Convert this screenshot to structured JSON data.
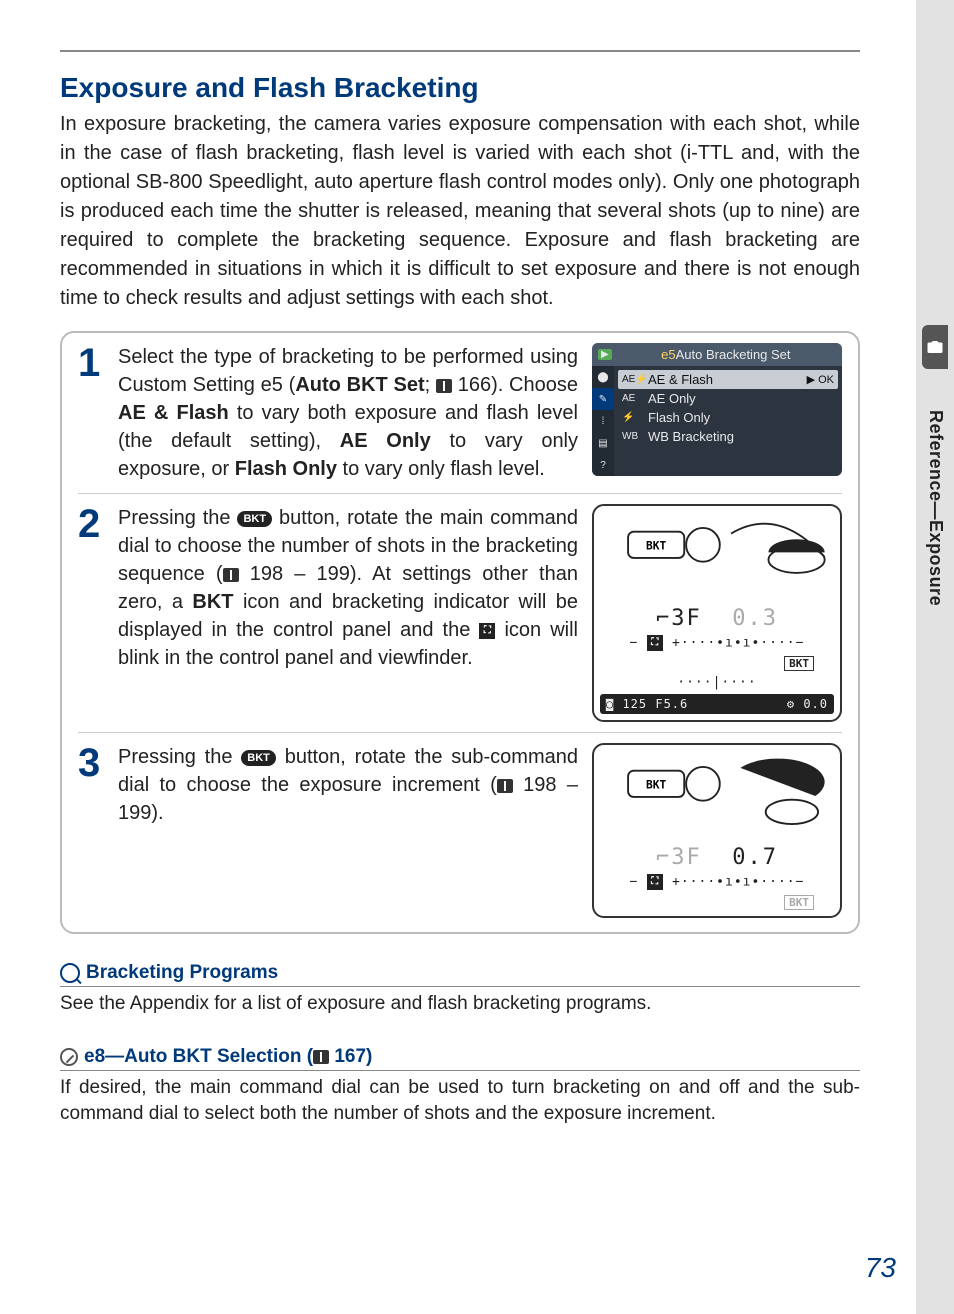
{
  "sidebar": {
    "label": "Reference—Exposure"
  },
  "title": "Exposure and Flash Bracketing",
  "intro": "In exposure bracketing, the camera varies exposure compensation with each shot, while in the case of flash bracketing, flash level is varied with each shot (i-TTL and, with the optional SB-800 Speedlight, auto aperture flash control modes only). Only one photograph is produced each time the shutter is released, meaning that several shots (up to nine) are required to complete the bracketing sequence. Exposure and flash bracketing are recommended in situations in which it is difficult to set exposure and there is not enough time to check results and adjust settings with each shot.",
  "steps": {
    "s1": {
      "num": "1",
      "t1": "Select the type of bracketing to be performed using Custom Setting e5 (",
      "bold1": "Auto BKT Set",
      "t2": "; ",
      "page_ref": " 166). Choose ",
      "bold2": "AE & Flash",
      "t3": " to vary both exposure and flash level (the default setting), ",
      "bold3": "AE Only",
      "t4": " to vary only exposure, or ",
      "bold4": "Flash Only",
      "t5": " to vary only flash level."
    },
    "s2": {
      "num": "2",
      "t1": "Pressing the ",
      "btn": "BKT",
      "t2": " button, rotate the main command dial to choose the number of shots in the bracketing sequence (",
      "page_ref": " 198 – 199). At settings other than zero, a ",
      "bold1": "BKT",
      "t3": " icon and bracketing indicator will be displayed in the control panel and the ",
      "t4": " icon will blink in the control panel and viewfinder."
    },
    "s3": {
      "num": "3",
      "t1": "Pressing the ",
      "btn": "BKT",
      "t2": " button, rotate the sub-command dial to choose the exposure increment (",
      "page_ref": " 198 – 199)."
    }
  },
  "menu": {
    "header_prefix": "e5",
    "header": "Auto Bracketing Set",
    "items": [
      {
        "code": "AE⚡",
        "label": "AE & Flash",
        "ok": "▶ OK"
      },
      {
        "code": "AE",
        "label": "AE Only"
      },
      {
        "code": "⚡",
        "label": "Flash Only"
      },
      {
        "code": "WB",
        "label": "WB Bracketing"
      }
    ]
  },
  "fig2": {
    "lcd_main_left": "⌐3F",
    "lcd_main_right": "0.3",
    "bkt_label": "BKT",
    "vf_left": "125  F5.6",
    "vf_right": "0.0"
  },
  "fig3": {
    "lcd_main_left": "⌐3F",
    "lcd_main_right": "0.7",
    "bkt_label": "BKT"
  },
  "notes": {
    "n1": {
      "title": "Bracketing Programs",
      "body": "See the Appendix for a list of exposure and flash bracketing programs."
    },
    "n2": {
      "title_a": "e8—Auto BKT Selection (",
      "title_pg": " 167)",
      "body": "If desired, the main command dial can be used to turn bracketing on and off and the sub-command dial to select both the number of shots and the exposure increment."
    }
  },
  "page_number": "73"
}
